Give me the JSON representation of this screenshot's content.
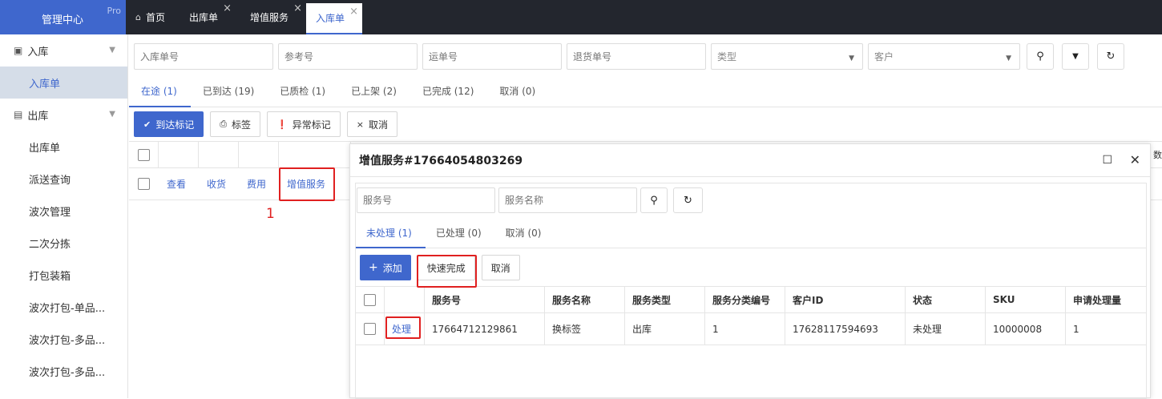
{
  "brand": {
    "title": "管理中心",
    "badge": "Pro"
  },
  "tabs": [
    {
      "label": "首页",
      "closable": false,
      "active": false
    },
    {
      "label": "出库单",
      "closable": true,
      "active": false
    },
    {
      "label": "增值服务",
      "closable": true,
      "active": false
    },
    {
      "label": "入库单",
      "closable": true,
      "active": true
    }
  ],
  "sidebar": {
    "groups": [
      {
        "label": "入库",
        "icon": "inbox-icon",
        "items": [
          {
            "label": "入库单",
            "active": true
          }
        ]
      },
      {
        "label": "出库",
        "icon": "truck-icon",
        "items": [
          {
            "label": "出库单"
          },
          {
            "label": "派送查询"
          },
          {
            "label": "波次管理"
          },
          {
            "label": "二次分拣"
          },
          {
            "label": "打包装箱"
          },
          {
            "label": "波次打包-单品..."
          },
          {
            "label": "波次打包-多品..."
          },
          {
            "label": "波次打包-多品..."
          }
        ]
      }
    ]
  },
  "filters": {
    "inbound_no": {
      "placeholder": "入库单号"
    },
    "reference_no": {
      "placeholder": "参考号"
    },
    "waybill_no": {
      "placeholder": "运单号"
    },
    "return_no": {
      "placeholder": "退货单号"
    },
    "type": {
      "placeholder": "类型"
    },
    "customer": {
      "placeholder": "客户"
    }
  },
  "status_tabs": [
    {
      "label": "在途 (1)",
      "active": true
    },
    {
      "label": "已到达 (19)"
    },
    {
      "label": "已质检 (1)"
    },
    {
      "label": "已上架 (2)"
    },
    {
      "label": "已完成 (12)"
    },
    {
      "label": "取消 (0)"
    }
  ],
  "actions": {
    "arrival": "到达标记",
    "label": "标签",
    "exception": "异常标记",
    "cancel": "取消"
  },
  "row_actions": {
    "view": "查看",
    "receive": "收货",
    "fee": "费用",
    "vas": "增值服务"
  },
  "header_overflow": "数",
  "annotation_1": "1",
  "dialog": {
    "title": "增值服务#17664054803269",
    "filters": {
      "service_no": {
        "placeholder": "服务号"
      },
      "service_name": {
        "placeholder": "服务名称"
      }
    },
    "tabs": [
      {
        "label": "未处理 (1)",
        "active": true
      },
      {
        "label": "已处理 (0)"
      },
      {
        "label": "取消 (0)"
      }
    ],
    "buttons": {
      "add": "添加",
      "quick_complete": "快速完成",
      "cancel": "取消"
    },
    "columns": [
      "服务号",
      "服务名称",
      "服务类型",
      "服务分类编号",
      "客户ID",
      "状态",
      "SKU",
      "申请处理量"
    ],
    "rows": [
      {
        "action": "处理",
        "service_no": "17664712129861",
        "service_name": "换标签",
        "service_type": "出库",
        "category_no": "1",
        "customer_id": "17628117594693",
        "status": "未处理",
        "sku": "10000008",
        "qty": "1"
      }
    ]
  },
  "colors": {
    "accent": "#3f67cd",
    "topbar": "#23262e",
    "highlight": "#e02020"
  }
}
